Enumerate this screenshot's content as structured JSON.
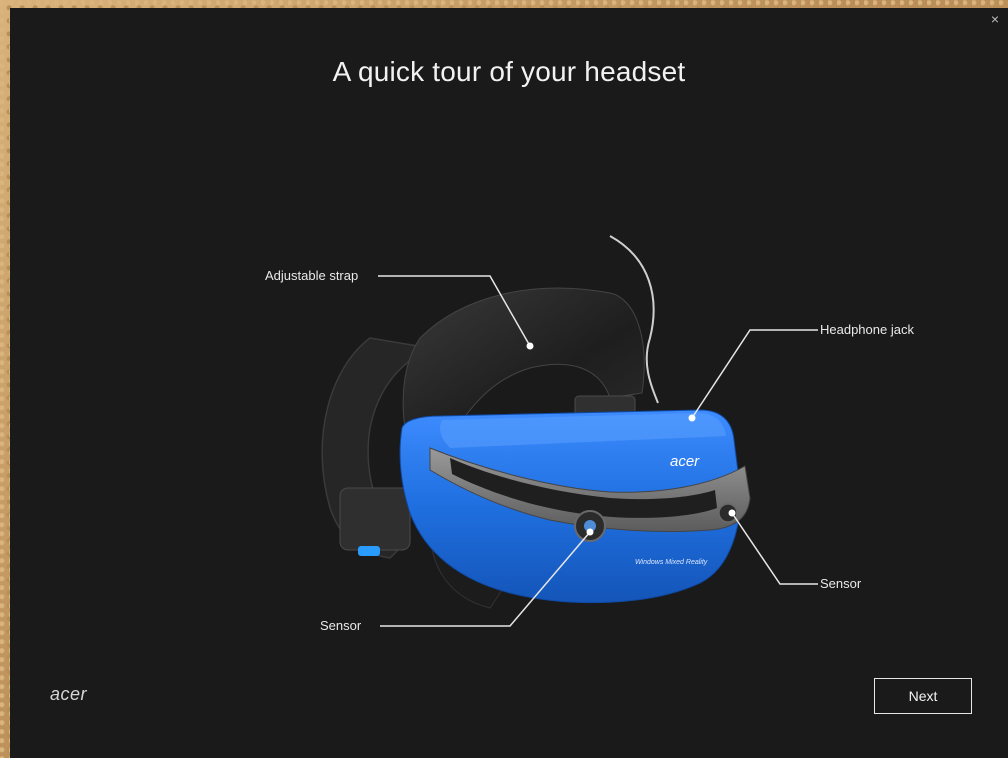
{
  "window": {
    "title": "A quick tour of your headset",
    "close_glyph": "×"
  },
  "callouts": {
    "adjustable_strap": "Adjustable strap",
    "headphone_jack": "Headphone jack",
    "sensor_right": "Sensor",
    "sensor_left": "Sensor"
  },
  "headset": {
    "brand_label": "acer",
    "model_label": "Windows Mixed Reality",
    "accent_color": "#1f6fe0",
    "strap_color": "#2a2a2a"
  },
  "footer": {
    "logo": "acer",
    "next_label": "Next"
  },
  "icons": {
    "close": "close-icon"
  }
}
